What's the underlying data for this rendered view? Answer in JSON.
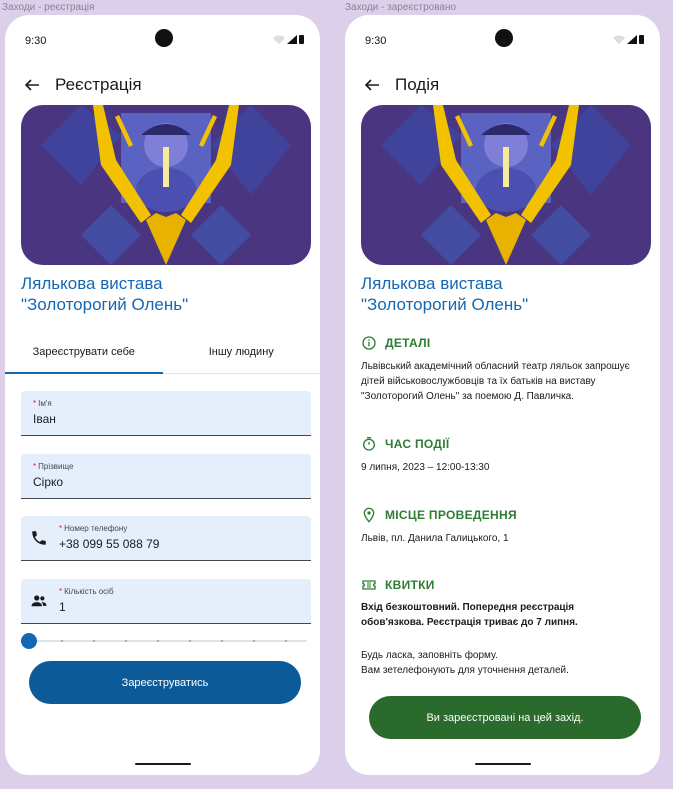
{
  "frames": {
    "left_label": "Заходи - реєстрація",
    "right_label": "Заходи - зареєстровано"
  },
  "status": {
    "time": "9:30"
  },
  "event": {
    "title": "Лялькова вистава\n\"Золоторогий Олень\""
  },
  "registration": {
    "appbar_title": "Реєстрація",
    "tabs": [
      "Зареєструвати себе",
      "Іншу людину"
    ],
    "fields": {
      "first_name": {
        "label": "Ім'я",
        "value": "Іван"
      },
      "last_name": {
        "label": "Прізвище",
        "value": "Сірко"
      },
      "phone": {
        "label": "Номер телефону",
        "value": "+38 099 55 088 79"
      },
      "people": {
        "label": "Кількість осіб",
        "value": "1"
      }
    },
    "slider_value": 1,
    "submit_label": "Зареєструватись"
  },
  "event_page": {
    "appbar_title": "Подія",
    "details_heading": "ДЕТАЛІ",
    "details_text": "Львівський академічний обласний театр ляльок запрошує дітей військовослужбовців та їх батьків на виставу \"Золоторогий Олень\" за поемою Д. Павличка.",
    "time_heading": "ЧАС ПОДІЇ",
    "time_text": "9 липня, 2023 – 12:00-13:30",
    "place_heading": "МІСЦЕ ПРОВЕДЕННЯ",
    "place_text": "Львів, пл. Данила Галицького, 1",
    "tickets_heading": "КВИТКИ",
    "tickets_bold": "Вхід безкоштовний. Попередня реєстрація обов'язкова. Реєстрація триває до 7 липня.",
    "tickets_text_1": "Будь ласка, заповніть форму.",
    "tickets_text_2": "Вам зетелефонують для уточнення деталей.",
    "registered_label": "Ви зареєстровані на цей захід."
  },
  "colors": {
    "background": "#dccfe9",
    "primary": "#1468b3",
    "primary_button": "#0c5a98",
    "success": "#2e7d32",
    "banner": "#4a3580"
  }
}
